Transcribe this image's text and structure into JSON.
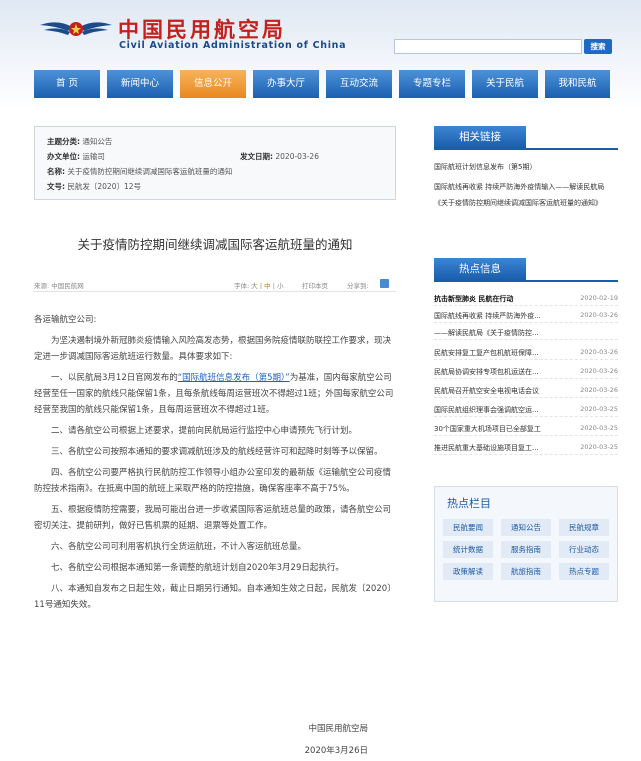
{
  "site": {
    "name_cn": "中国民用航空局",
    "name_en": "Civil Aviation Administration of China"
  },
  "search": {
    "placeholder": "",
    "button": "搜索"
  },
  "nav": [
    "首 页",
    "新闻中心",
    "信息公开",
    "办事大厅",
    "互动交流",
    "专题专栏",
    "关于民航",
    "我和民航"
  ],
  "nav_active": 2,
  "meta": {
    "category_label": "主题分类:",
    "category": "通知公告",
    "office_label": "办文单位:",
    "office": "运输司",
    "date_label": "发文日期:",
    "date": "2020-03-26",
    "name_label": "名称:",
    "name": "关于疫情防控期间继续调减国际客运航班量的通知",
    "doc_no_label": "文号:",
    "doc_no": "民航发〔2020〕12号"
  },
  "article": {
    "title": "关于疫情防控期间继续调减国际客运航班量的通知",
    "source": "来源: 中国民航网",
    "font_label": "字体:",
    "font_large": "大",
    "font_medium": "中",
    "font_small": "小",
    "sep": "|",
    "print": "打印本页",
    "share": "分享到:",
    "salutation": "各运输航空公司:",
    "intro": "为坚决遏制境外新冠肺炎疫情输入风险高发态势，根据国务院疫情联防联控工作要求，现决定进一步调减国际客运航班运行数量。具体要求如下:",
    "p1_before": "一、以民航局3月12日官网发布的",
    "p1_link": "“国际航班信息发布（第5期）”",
    "p1_after": "为基准，国内每家航空公司经营至任一国家的航线只能保留1条，且每条航线每周运营班次不得超过1班；外国每家航空公司经营至我国的航线只能保留1条，且每周运营班次不得超过1班。",
    "p2": "二、请各航空公司根据上述要求，提前向民航局运行监控中心申请预先飞行计划。",
    "p3": "三、各航空公司按照本通知的要求调减航班涉及的航线经营许可和起降时刻等予以保留。",
    "p4": "四、各航空公司要严格执行民航防控工作领导小组办公室印发的最新版《运输航空公司疫情防控技术指南》。在抵离中国的航班上采取严格的防控措施，确保客座率不高于75%。",
    "p5": "五、根据疫情防控需要，我局可能出台进一步收紧国际客运航班总量的政策，请各航空公司密切关注、提前研判，做好已售机票的延期、退票等处置工作。",
    "p6": "六、各航空公司可利用客机执行全货运航班，不计入客运航班总量。",
    "p7": "七、各航空公司根据本通知第一条调整的航班计划自2020年3月29日起执行。",
    "p8": "八、本通知自发布之日起生效，截止日期另行通知。自本通知生效之日起，民航发〔2020〕11号通知失效。",
    "sign_org": "中国民用航空局",
    "sign_date": "2020年3月26日"
  },
  "related": {
    "heading": "相关链接",
    "items": [
      "国际航班计划信息发布（第5期）",
      "国际航线再收紧 持续严防海外疫情输入——解读民航局《关于疫情防控期间继续调减国际客运航班量的通知》"
    ]
  },
  "hot": {
    "heading": "热点信息",
    "items": [
      {
        "title": "抗击新型肺炎 民航在行动",
        "date": "2020-02-19"
      },
      {
        "title": "国际航线再收紧 持续严防海外疫...",
        "date": "2020-03-26"
      },
      {
        "title": "——解读民航局《关于疫情防控...",
        "date": ""
      },
      {
        "title": "民航安排复工复产包机航班保障...",
        "date": "2020-03-26"
      },
      {
        "title": "民航局协调安排专项包机运送在...",
        "date": "2020-03-26"
      },
      {
        "title": "民航局召开航空安全电视电话会议",
        "date": "2020-03-26"
      },
      {
        "title": "国际民航组织理事会强调航空运...",
        "date": "2020-03-25"
      },
      {
        "title": "30个国家重大机场项目已全部复工",
        "date": "2020-03-25"
      },
      {
        "title": "推进民航重大基础设施项目复工...",
        "date": "2020-03-25"
      }
    ]
  },
  "columns": {
    "heading": "热点栏目",
    "items": [
      "民航要闻",
      "通知公告",
      "民航规章",
      "统计数据",
      "服务指南",
      "行业动态",
      "政策解读",
      "航旅指南",
      "热点专题"
    ]
  },
  "colors": {
    "brand_red": "#c4201c",
    "brand_blue": "#1a5dab",
    "nav_active": "#f0a040"
  }
}
